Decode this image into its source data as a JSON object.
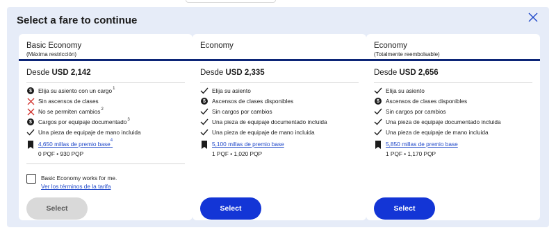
{
  "modal": {
    "title": "Select a fare to continue",
    "close_icon": "close-icon"
  },
  "colors": {
    "accent_blue": "#1335d6",
    "link_blue": "#1f48c9",
    "header_rule": "#0c2577",
    "panel_bg": "#e6ecf8",
    "disabled_button": "#d9d9d9"
  },
  "fares": [
    {
      "name": "Basic Economy",
      "subtitle": "(Máxima restricción)",
      "price_prefix": "Desde",
      "price": "USD 2,142",
      "features": [
        {
          "icon": "dollar-icon",
          "text": "Elija su asiento con un cargo",
          "sup": "1"
        },
        {
          "icon": "x-icon",
          "text": "Sin ascensos de clases",
          "sup": ""
        },
        {
          "icon": "x-icon",
          "text": "No se permiten cambios",
          "sup": "2"
        },
        {
          "icon": "dollar-icon",
          "text": "Cargos por equipaje documentado",
          "sup": "3"
        },
        {
          "icon": "check-icon",
          "text": "Una pieza de equipaje de mano incluida",
          "sup": ""
        }
      ],
      "miles": {
        "text": "4,650 millas de premio base",
        "sup": "4"
      },
      "pqf_pqp": "0 PQF • 930 PQP",
      "agreement": {
        "label": "Basic Economy works for me.",
        "terms": "Ver los términos de la tarifa"
      },
      "button": "Select",
      "button_state": "disabled"
    },
    {
      "name": "Economy",
      "subtitle": "",
      "price_prefix": "Desde",
      "price": "USD 2,335",
      "features": [
        {
          "icon": "check-icon",
          "text": "Elija su asiento",
          "sup": ""
        },
        {
          "icon": "dollar-icon",
          "text": "Ascensos de clases disponibles",
          "sup": ""
        },
        {
          "icon": "check-icon",
          "text": "Sin cargos por cambios",
          "sup": ""
        },
        {
          "icon": "check-icon",
          "text": "Una pieza de equipaje documentado incluida",
          "sup": ""
        },
        {
          "icon": "check-icon",
          "text": "Una pieza de equipaje de mano incluida",
          "sup": ""
        }
      ],
      "miles": {
        "text": "5,100 millas de premio base",
        "sup": ""
      },
      "pqf_pqp": "1 PQF • 1,020 PQP",
      "button": "Select",
      "button_state": "enabled"
    },
    {
      "name": "Economy",
      "subtitle": "(Totalmente reembolsable)",
      "price_prefix": "Desde",
      "price": "USD 2,656",
      "features": [
        {
          "icon": "check-icon",
          "text": "Elija su asiento",
          "sup": ""
        },
        {
          "icon": "dollar-icon",
          "text": "Ascensos de clases disponibles",
          "sup": ""
        },
        {
          "icon": "check-icon",
          "text": "Sin cargos por cambios",
          "sup": ""
        },
        {
          "icon": "check-icon",
          "text": "Una pieza de equipaje documentado incluida",
          "sup": ""
        },
        {
          "icon": "check-icon",
          "text": "Una pieza de equipaje de mano incluida",
          "sup": ""
        }
      ],
      "miles": {
        "text": "5,850 millas de premio base",
        "sup": ""
      },
      "pqf_pqp": "1 PQF • 1,170 PQP",
      "button": "Select",
      "button_state": "enabled"
    }
  ]
}
